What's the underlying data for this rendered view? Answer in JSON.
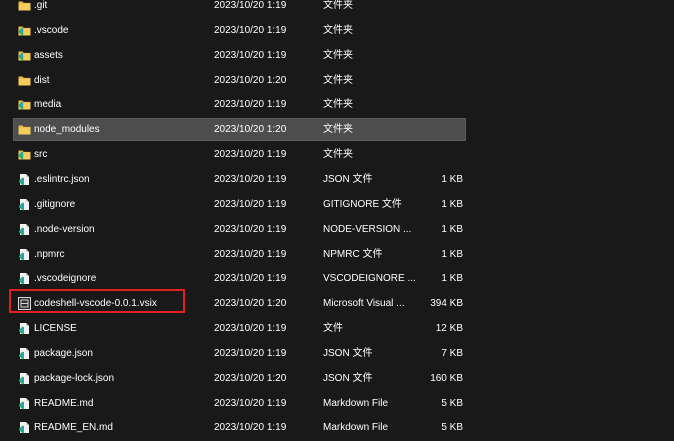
{
  "rows": [
    {
      "name": ".git",
      "date": "2023/10/20 1:19",
      "type": "文件夹",
      "size": "",
      "icon": "folder-icon",
      "selected": false
    },
    {
      "name": ".vscode",
      "date": "2023/10/20 1:19",
      "type": "文件夹",
      "size": "",
      "icon": "folder-vscode-icon",
      "selected": false
    },
    {
      "name": "assets",
      "date": "2023/10/20 1:19",
      "type": "文件夹",
      "size": "",
      "icon": "folder-vscode-icon",
      "selected": false
    },
    {
      "name": "dist",
      "date": "2023/10/20 1:20",
      "type": "文件夹",
      "size": "",
      "icon": "folder-icon",
      "selected": false
    },
    {
      "name": "media",
      "date": "2023/10/20 1:19",
      "type": "文件夹",
      "size": "",
      "icon": "folder-vscode-icon",
      "selected": false
    },
    {
      "name": "node_modules",
      "date": "2023/10/20 1:20",
      "type": "文件夹",
      "size": "",
      "icon": "folder-icon",
      "selected": true
    },
    {
      "name": "src",
      "date": "2023/10/20 1:19",
      "type": "文件夹",
      "size": "",
      "icon": "folder-vscode-icon",
      "selected": false
    },
    {
      "name": ".eslintrc.json",
      "date": "2023/10/20 1:19",
      "type": "JSON 文件",
      "size": "1 KB",
      "icon": "vscode-file-icon",
      "selected": false
    },
    {
      "name": ".gitignore",
      "date": "2023/10/20 1:19",
      "type": "GITIGNORE 文件",
      "size": "1 KB",
      "icon": "vscode-file-icon",
      "selected": false
    },
    {
      "name": ".node-version",
      "date": "2023/10/20 1:19",
      "type": "NODE-VERSION ...",
      "size": "1 KB",
      "icon": "vscode-file-icon",
      "selected": false
    },
    {
      "name": ".npmrc",
      "date": "2023/10/20 1:19",
      "type": "NPMRC 文件",
      "size": "1 KB",
      "icon": "vscode-file-icon",
      "selected": false
    },
    {
      "name": ".vscodeignore",
      "date": "2023/10/20 1:19",
      "type": "VSCODEIGNORE ...",
      "size": "1 KB",
      "icon": "vscode-file-icon",
      "selected": false
    },
    {
      "name": "codeshell-vscode-0.0.1.vsix",
      "date": "2023/10/20 1:20",
      "type": "Microsoft Visual ...",
      "size": "394 KB",
      "icon": "vsix-package-icon",
      "selected": false
    },
    {
      "name": "LICENSE",
      "date": "2023/10/20 1:19",
      "type": "文件",
      "size": "12 KB",
      "icon": "vscode-file-icon",
      "selected": false
    },
    {
      "name": "package.json",
      "date": "2023/10/20 1:19",
      "type": "JSON 文件",
      "size": "7 KB",
      "icon": "vscode-file-icon",
      "selected": false
    },
    {
      "name": "package-lock.json",
      "date": "2023/10/20 1:20",
      "type": "JSON 文件",
      "size": "160 KB",
      "icon": "vscode-file-icon",
      "selected": false
    },
    {
      "name": "README.md",
      "date": "2023/10/20 1:19",
      "type": "Markdown File",
      "size": "5 KB",
      "icon": "vscode-file-icon",
      "selected": false
    },
    {
      "name": "README_EN.md",
      "date": "2023/10/20 1:19",
      "type": "Markdown File",
      "size": "5 KB",
      "icon": "vscode-file-icon",
      "selected": false
    }
  ],
  "colors": {
    "background": "#191919",
    "selected": "#4d4d4d",
    "folder": "#e9b948",
    "vscode_blue": "#2b9ae6",
    "vscode_green": "#29b36a",
    "highlight": "#e0201f"
  }
}
